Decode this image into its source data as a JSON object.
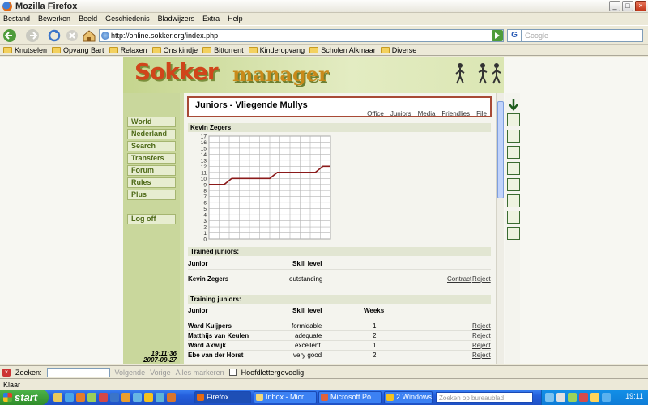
{
  "window": {
    "title": "Mozilla Firefox"
  },
  "menu": [
    "Bestand",
    "Bewerken",
    "Beeld",
    "Geschiedenis",
    "Bladwijzers",
    "Extra",
    "Help"
  ],
  "nav": {
    "url": "http://online.sokker.org/index.php",
    "search_placeholder": "Google"
  },
  "bookmarks": [
    "Knutselen",
    "Opvang Bart",
    "Relaxen",
    "Ons kindje",
    "Bittorrent",
    "Kinderopvang",
    "Scholen Alkmaar",
    "Diverse"
  ],
  "site": {
    "logo_a": "Sokker",
    "logo_b": "manager",
    "sidebar": [
      "World",
      "Nederland",
      "Search",
      "Transfers",
      "Forum",
      "Rules",
      "Plus"
    ],
    "logoff": "Log off",
    "time": "19:11:36",
    "date": "2007-09-27"
  },
  "page": {
    "title": "Juniors - Vliegende Mullys",
    "tabs": [
      "Office",
      "Juniors",
      "Media",
      "Friendlies",
      "File"
    ],
    "player_name": "Kevin Zegers",
    "trained_header": "Trained juniors:",
    "trained_cols": [
      "Junior",
      "Skill level"
    ],
    "trained_rows": [
      {
        "name": "Kevin Zegers",
        "skill": "outstanding",
        "contract": "Contract",
        "reject": "Reject"
      }
    ],
    "training_header": "Training juniors:",
    "training_cols": [
      "Junior",
      "Skill level",
      "Weeks"
    ],
    "training_rows": [
      {
        "name": "Ward Kuijpers",
        "skill": "formidable",
        "weeks": "1",
        "reject": "Reject"
      },
      {
        "name": "Matthijs van Keulen",
        "skill": "adequate",
        "weeks": "2",
        "reject": "Reject"
      },
      {
        "name": "Ward Axwijk",
        "skill": "excellent",
        "weeks": "1",
        "reject": "Reject"
      },
      {
        "name": "Ebe van der Horst",
        "skill": "very good",
        "weeks": "2",
        "reject": "Reject"
      }
    ]
  },
  "chart_data": {
    "type": "line",
    "ylim": [
      0,
      17
    ],
    "yticks": [
      "0",
      "1",
      "2",
      "3",
      "4",
      "5",
      "6",
      "7",
      "8",
      "9",
      "10",
      "11",
      "12",
      "13",
      "14",
      "15",
      "16",
      "17"
    ],
    "x": [
      0,
      1,
      2,
      3,
      4,
      5,
      6,
      7,
      8,
      9,
      10,
      11,
      12,
      13,
      14,
      15,
      16
    ],
    "series": [
      {
        "values": [
          9,
          9,
          9,
          10,
          10,
          10,
          10,
          10,
          10,
          11,
          11,
          11,
          11,
          11,
          11,
          12,
          12
        ]
      }
    ],
    "grid": true,
    "line_color": "#8b1a1a"
  },
  "findbar": {
    "label": "Zoeken:",
    "next": "Volgende",
    "prev": "Vorige",
    "highlight": "Alles markeren",
    "match_case": "Hoofdlettergevoelig"
  },
  "status": "Klaar",
  "taskbar": {
    "start": "start",
    "tasks": [
      "Firefox",
      "Inbox - Micr...",
      "Microsoft Po...",
      "2 Windows ..."
    ],
    "search_placeholder": "Zoeken op bureaublad",
    "clock": "19:11"
  }
}
